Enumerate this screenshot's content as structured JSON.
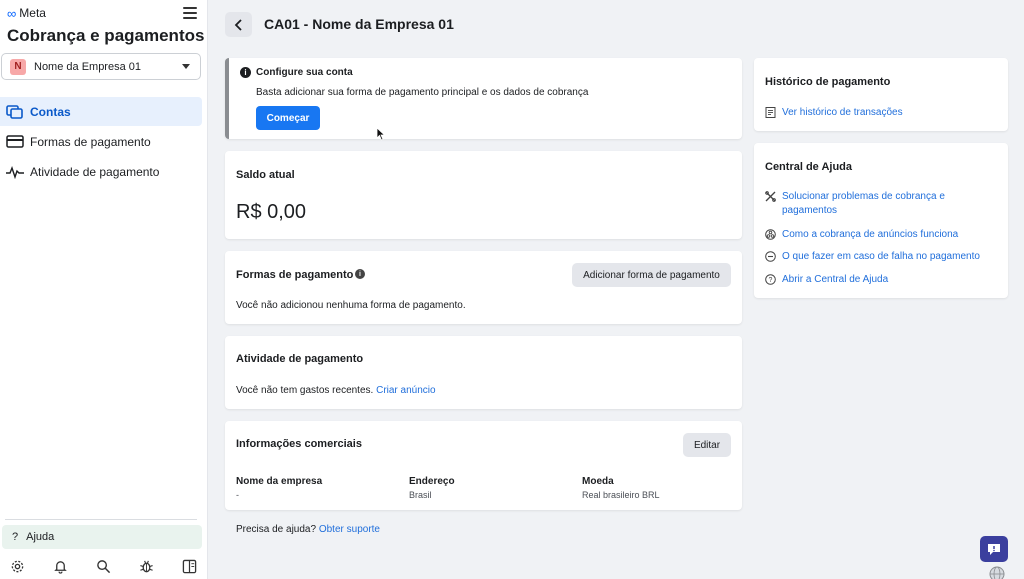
{
  "sidebar": {
    "brand": "Meta",
    "title": "Cobrança e pagamentos",
    "company": {
      "initial": "N",
      "name": "Nome da Empresa 01"
    },
    "nav": [
      {
        "label": "Contas",
        "icon": "accounts-icon",
        "active": true
      },
      {
        "label": "Formas de pagamento",
        "icon": "credit-card-icon",
        "active": false
      },
      {
        "label": "Atividade de pagamento",
        "icon": "activity-pulse-icon",
        "active": false
      }
    ],
    "help_label": "Ajuda",
    "bottom_icons": [
      "gear-icon",
      "bell-icon",
      "search-icon",
      "bug-icon",
      "panel-toggle-icon"
    ]
  },
  "header": {
    "title": "CA01 - Nome da Empresa 01"
  },
  "setup": {
    "title": "Configure sua conta",
    "description": "Basta adicionar sua forma de pagamento principal e os dados de cobrança",
    "button": "Começar"
  },
  "balance": {
    "title": "Saldo atual",
    "amount": "R$ 0,00"
  },
  "payment_methods": {
    "title": "Formas de pagamento",
    "button": "Adicionar forma de pagamento",
    "empty": "Você não adicionou nenhuma forma de pagamento."
  },
  "activity": {
    "title": "Atividade de pagamento",
    "empty": "Você não tem gastos recentes.",
    "link": "Criar anúncio"
  },
  "business_info": {
    "title": "Informações comerciais",
    "button": "Editar",
    "columns": [
      {
        "label": "Nome da empresa",
        "value": "-"
      },
      {
        "label": "Endereço",
        "value": "Brasil"
      },
      {
        "label": "Moeda",
        "value": "Real brasileiro BRL"
      }
    ]
  },
  "footer": {
    "question": "Precisa de ajuda?",
    "link": "Obter suporte"
  },
  "history": {
    "title": "Histórico de pagamento",
    "link": "Ver histórico de transações"
  },
  "help_center": {
    "title": "Central de Ajuda",
    "links": [
      {
        "label": "Solucionar problemas de cobrança e pagamentos",
        "icon": "tools-icon"
      },
      {
        "label": "Como a cobrança de anúncios funciona",
        "icon": "network-icon"
      },
      {
        "label": "O que fazer em caso de falha no pagamento",
        "icon": "minus-circle-icon"
      },
      {
        "label": "Abrir a Central de Ajuda",
        "icon": "question-circle-icon"
      }
    ]
  },
  "colors": {
    "primary": "#1877f2",
    "link": "#216fdb",
    "active_nav_bg": "#e7f0fd",
    "page_bg": "#f0f2f5"
  }
}
